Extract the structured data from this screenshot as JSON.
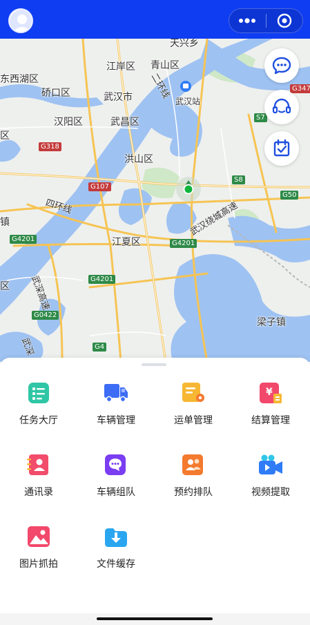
{
  "header": {
    "brand_color": "#0f3df2",
    "avatar_icon": "user-avatar",
    "more_icon": "more-dots-icon",
    "close_icon": "target-circle-icon"
  },
  "map": {
    "places": {
      "tianxingxiang": "天兴乡",
      "dongxihu": "东西湖区",
      "jiangan": "江岸区",
      "qingshan": "青山区",
      "qiaokou": "硚口区",
      "wuhanshi": "武汉市",
      "erhuan": "二环线",
      "wuhanzhan": "武汉站",
      "hanyang": "汉阳区",
      "wuchang": "武昌区",
      "hongshan": "洪山区",
      "sihuan": "四环线",
      "jiangxia": "江夏区",
      "wuhanrao": "武汉绕城高速",
      "wushen": "武深高速",
      "wushen2": "武深",
      "liangzizhen": "梁子镇",
      "qu_left1": "区",
      "qu_left2": "区",
      "zhen_left": "镇"
    },
    "highways": {
      "g4201a": "G4201",
      "g4201b": "G4201",
      "g4201c": "G4201",
      "g318": "G318",
      "g107": "G107",
      "s8": "S8",
      "g50": "G50",
      "s7": "S7",
      "g347": "G347",
      "g0422": "G0422",
      "g4": "G4"
    },
    "fab_buttons": [
      {
        "icon": "chat-bubble-icon"
      },
      {
        "icon": "headset-icon"
      },
      {
        "icon": "calendar-check-icon"
      }
    ]
  },
  "menu": [
    {
      "label": "任务大厅",
      "icon": "task-list-icon",
      "color": "#2fc6a5"
    },
    {
      "label": "车辆管理",
      "icon": "truck-icon",
      "color": "#3d6df5"
    },
    {
      "label": "运单管理",
      "icon": "waybill-icon",
      "color": "#f7b733"
    },
    {
      "label": "结算管理",
      "icon": "settlement-icon",
      "color": "#f2486b"
    },
    {
      "label": "通讯录",
      "icon": "contacts-icon",
      "color": "#f24d6b"
    },
    {
      "label": "车辆组队",
      "icon": "team-chat-icon",
      "color": "#7a3df2"
    },
    {
      "label": "预约排队",
      "icon": "queue-people-icon",
      "color": "#f37a2e"
    },
    {
      "label": "视频提取",
      "icon": "video-camera-icon",
      "color": "#2f7cf6"
    },
    {
      "label": "图片抓拍",
      "icon": "image-icon",
      "color": "#f2486b"
    },
    {
      "label": "文件缓存",
      "icon": "download-folder-icon",
      "color": "#2aa6f0"
    }
  ]
}
